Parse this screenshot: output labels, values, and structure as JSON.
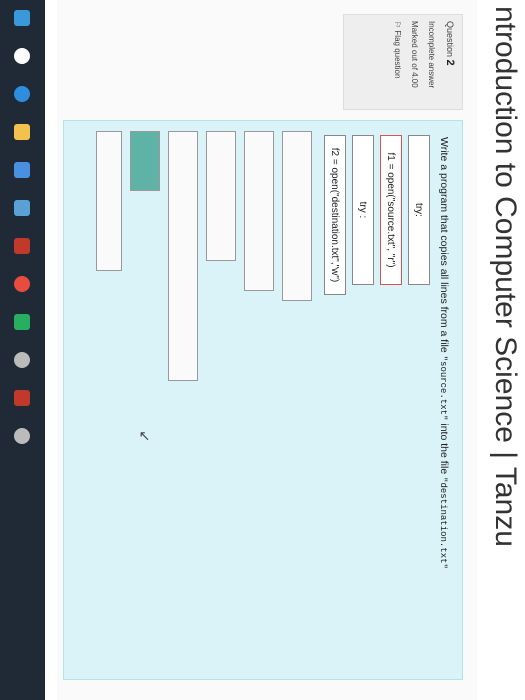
{
  "page": {
    "title": "ntroduction to Computer Science | Tanzu"
  },
  "info": {
    "question_label": "Question",
    "question_number": "2",
    "status": "Incomplete answer",
    "marked": "Marked out of 4.00",
    "flag": "Flag question"
  },
  "question": {
    "text_before": "Write a program that copies all lines from a file ",
    "source": "\"source.txt\"",
    "text_middle": " into the file ",
    "dest": "\"destination.txt\""
  },
  "placed": {
    "try1": "try:",
    "open1": "f1 = open(\"source.txt\", \"r\")",
    "try2": "try :",
    "open2": "f2 = open(\"destination.txt\",\"w\")"
  },
  "taskbar": {
    "icons": [
      "windows-icon",
      "search-icon",
      "edge-icon",
      "explorer-icon",
      "store-icon",
      "mail-icon",
      "photos-icon",
      "chrome-icon",
      "media-icon",
      "settings-icon",
      "pdf-icon",
      "settings2-icon"
    ],
    "colors": [
      "#3a9ad9",
      "#ffffff",
      "#2d8ee0",
      "#f2c14e",
      "#4a90e2",
      "#5aa2d6",
      "#c0392b",
      "#e74c3c",
      "#27ae60",
      "#bbbbbb",
      "#c0392b",
      "#bbbbbb"
    ]
  }
}
